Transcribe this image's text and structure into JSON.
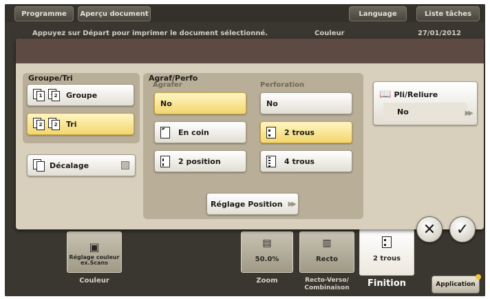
{
  "topbar": {
    "programme": "Programme",
    "apercu": "Aperçu document",
    "language": "Language",
    "liste_taches": "Liste tâches"
  },
  "status": {
    "message": "Appuyez sur Départ pour imprimer le document sélectionné.",
    "mode": "Couleur",
    "date": "27/01/2012"
  },
  "groupe_tri": {
    "title": "Groupe/Tri",
    "groupe": "Groupe",
    "tri": "Tri",
    "decalage": "Décalage"
  },
  "agraf_perfo": {
    "title": "Agraf/Perfo",
    "agrafer": {
      "label": "Agrafer",
      "options": [
        "No",
        "En coin",
        "2 position"
      ],
      "selected": "No"
    },
    "perforation": {
      "label": "Perforation",
      "options": [
        "No",
        "2 trous",
        "4 trous"
      ],
      "selected": "2 trous"
    },
    "reglage_position": "Réglage Position"
  },
  "pli_reliure": {
    "title": "Pli/Reliure",
    "value": "No"
  },
  "actions": {
    "cancel": "✕",
    "ok": "✓"
  },
  "bottom": {
    "couleur_tile": "Réglage couleur ex.Scans",
    "couleur_label": "Couleur",
    "zoom_value": "50.0%",
    "zoom_label": "Zoom",
    "recto_value": "Recto",
    "recto_label": "Recto-Verso/ Combinaison",
    "finition_value": "2 trous",
    "finition_label": "Finition",
    "application": "Application"
  },
  "colors": {
    "selected_fill": "#f3d66e",
    "dialog_bg": "#d8d0bd",
    "panel_bg": "#b9ae98",
    "header_bar": "#5d4a42"
  }
}
